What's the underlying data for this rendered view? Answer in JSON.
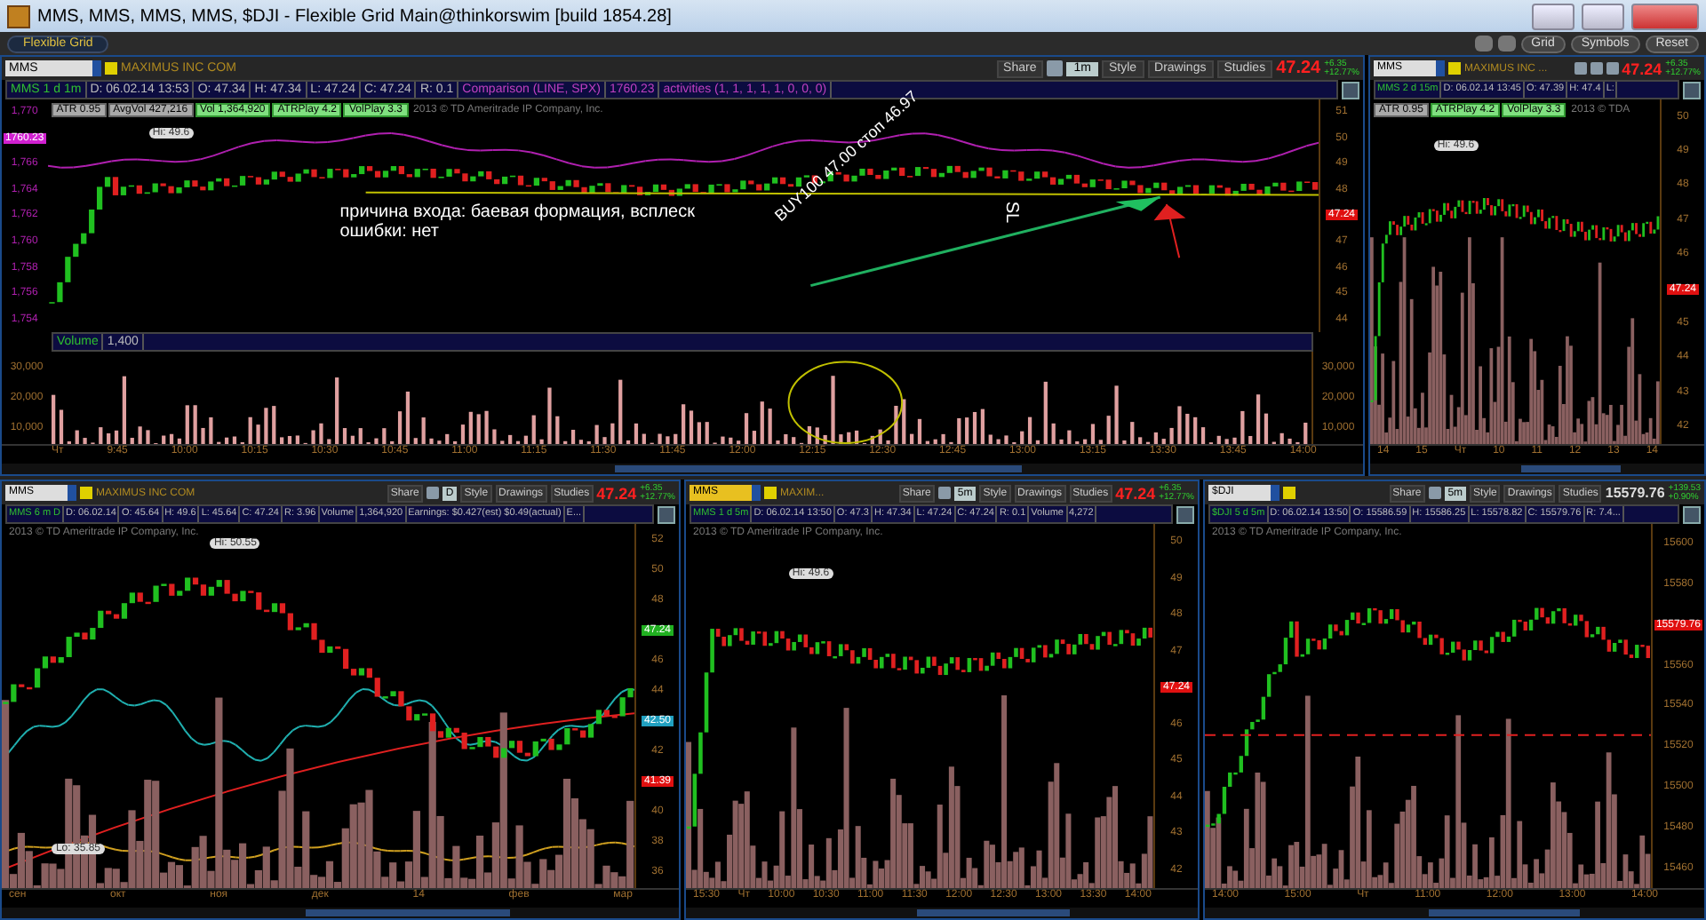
{
  "window": {
    "title": "MMS, MMS, MMS, MMS, $DJI - Flexible Grid Main@thinkorswim [build 1854.28]"
  },
  "toolbar": {
    "tab": "Flexible Grid",
    "buttons": [
      "Grid",
      "Symbols",
      "Reset"
    ]
  },
  "top_row": [
    {
      "symbol": "MMS",
      "highlighted": false,
      "company": "MAXIMUS INC COM",
      "buttons": [
        "Share",
        "Style",
        "Drawings",
        "Studies"
      ],
      "aggregation": "1m",
      "price": "47.24",
      "change": "+6.35",
      "change_pct": "+12.77%",
      "info": [
        "MMS 1 d 1m",
        "D: 06.02.14 13:53",
        "O: 47.34",
        "H: 47.34",
        "L: 47.24",
        "C: 47.24",
        "R: 0.1",
        "Comparison (LINE, SPX)",
        "1760.23",
        "activities (1, 1, 1, 1, 1, 0, 0, 0)"
      ],
      "studies": [
        "ATR 0.95",
        "AvgVol 427,216",
        "Vol 1,364,920",
        "ATRPlay 4.2",
        "VolPlay 3.3"
      ],
      "copyright": "2013 © TD Ameritrade IP Company, Inc.",
      "hi": "Hi: 49.6",
      "left_labels": [
        "1,770",
        "1,766",
        "1,764",
        "1,762",
        "1,760",
        "1,758",
        "1,756",
        "1,754"
      ],
      "y_labels": [
        "51",
        "50",
        "49",
        "48",
        "47",
        "46",
        "45",
        "44"
      ],
      "price_tags": [
        {
          "text": "47.24",
          "color": "#e01010"
        },
        {
          "text": "1760.23",
          "color": "#d020d0"
        }
      ],
      "annotations": [
        {
          "kind": "note",
          "text": "причина входа: баевая формация, всплеск ошибки: нет"
        },
        {
          "kind": "buy",
          "text": "BUY100 47.00 стоп 46.97"
        },
        {
          "kind": "sl",
          "text": "SL"
        }
      ],
      "volume": {
        "label": "Volume",
        "value": "1,400",
        "left_labels": [
          "30,000",
          "20,000",
          "10,000"
        ],
        "right_labels": [
          "30,000",
          "20,000",
          "10,000"
        ]
      },
      "x_labels": [
        "Чт",
        "9:45",
        "10:00",
        "10:15",
        "10:30",
        "10:45",
        "11:00",
        "11:15",
        "11:30",
        "11:45",
        "12:00",
        "12:15",
        "12:30",
        "12:45",
        "13:00",
        "13:15",
        "13:30",
        "13:45",
        "14:00"
      ]
    },
    {
      "symbol": "MMS",
      "highlighted": false,
      "company": "MAXIMUS INC ...",
      "price": "47.24",
      "change": "+6.35",
      "change_pct": "+12.77%",
      "info": [
        "MMS 2 d 15m",
        "D: 06.02.14 13:45",
        "O: 47.39",
        "H: 47.4",
        "L:"
      ],
      "studies": [
        "ATR 0.95",
        "ATRPlay 4.2",
        "VolPlay 3.3"
      ],
      "copyright": "2013 © TDA",
      "hi": "Hi: 49.6",
      "y_labels": [
        "50",
        "49",
        "48",
        "47",
        "46",
        "45",
        "44",
        "43",
        "42"
      ],
      "price_tags": [
        {
          "text": "47.24",
          "color": "#e01010"
        }
      ],
      "x_labels": [
        "14",
        "15",
        "Чт",
        "10",
        "11",
        "12",
        "13",
        "14"
      ]
    }
  ],
  "bottom_row": [
    {
      "symbol": "MMS",
      "highlighted": false,
      "company": "MAXIMUS INC COM",
      "buttons": [
        "Share",
        "Style",
        "Drawings",
        "Studies"
      ],
      "aggregation": "D",
      "price": "47.24",
      "change": "+6.35",
      "change_pct": "+12.77%",
      "info": [
        "MMS 6 m D",
        "D: 06.02.14",
        "O: 45.64",
        "H: 49.6",
        "L: 45.64",
        "C: 47.24",
        "R: 3.96",
        "Volume",
        "1,364,920",
        "Earnings: $0.427(est) $0.49(actual)",
        "E..."
      ],
      "copyright": "2013 © TD Ameritrade IP Company, Inc.",
      "hi": "Hi: 50.55",
      "lo": "Lo: 35.85",
      "y_labels": [
        "52",
        "50",
        "48",
        "46",
        "44",
        "42",
        "40",
        "38",
        "36"
      ],
      "price_tags": [
        {
          "text": "47.24",
          "color": "#20b020"
        },
        {
          "text": "42.50",
          "color": "#20a0c0"
        },
        {
          "text": "41.39",
          "color": "#e01010"
        }
      ],
      "x_labels": [
        "сен",
        "окт",
        "ноя",
        "дек",
        "14",
        "фев",
        "мар"
      ]
    },
    {
      "symbol": "MMS",
      "highlighted": true,
      "company": "MAXIM...",
      "buttons": [
        "Share",
        "Style",
        "Drawings",
        "Studies"
      ],
      "aggregation": "5m",
      "price": "47.24",
      "change": "+6.35",
      "change_pct": "+12.77%",
      "info": [
        "MMS 1 d 5m",
        "D: 06.02.14 13:50",
        "O: 47.3",
        "H: 47.34",
        "L: 47.24",
        "C: 47.24",
        "R: 0.1",
        "Volume",
        "4,272"
      ],
      "copyright": "2013 © TD Ameritrade IP Company, Inc.",
      "hi": "Hi: 49.6",
      "y_labels": [
        "50",
        "49",
        "48",
        "47",
        "46",
        "45",
        "44",
        "43",
        "42"
      ],
      "price_tags": [
        {
          "text": "47.24",
          "color": "#e01010"
        }
      ],
      "x_labels": [
        "15:30",
        "Чт",
        "10:00",
        "10:30",
        "11:00",
        "11:30",
        "12:00",
        "12:30",
        "13:00",
        "13:30",
        "14:00"
      ]
    },
    {
      "symbol": "$DJI",
      "highlighted": false,
      "buttons": [
        "Share",
        "Style",
        "Drawings",
        "Studies"
      ],
      "aggregation": "5m",
      "price": "15579.76",
      "change": "+139.53",
      "change_pct": "+0.90%",
      "info": [
        "$DJI 5 d 5m",
        "D: 06.02.14 13:50",
        "O: 15586.59",
        "H: 15586.25",
        "L: 15578.82",
        "C: 15579.76",
        "R: 7.4..."
      ],
      "copyright": "2013 © TD Ameritrade IP Company, Inc.",
      "y_labels": [
        "15600",
        "15580",
        "15560",
        "15540",
        "15520",
        "15500",
        "15480",
        "15460"
      ],
      "price_tags": [
        {
          "text": "15579.76",
          "color": "#e01010"
        }
      ],
      "x_labels": [
        "14:00",
        "15:00",
        "Чт",
        "11:00",
        "12:00",
        "13:00",
        "14:00"
      ]
    }
  ]
}
